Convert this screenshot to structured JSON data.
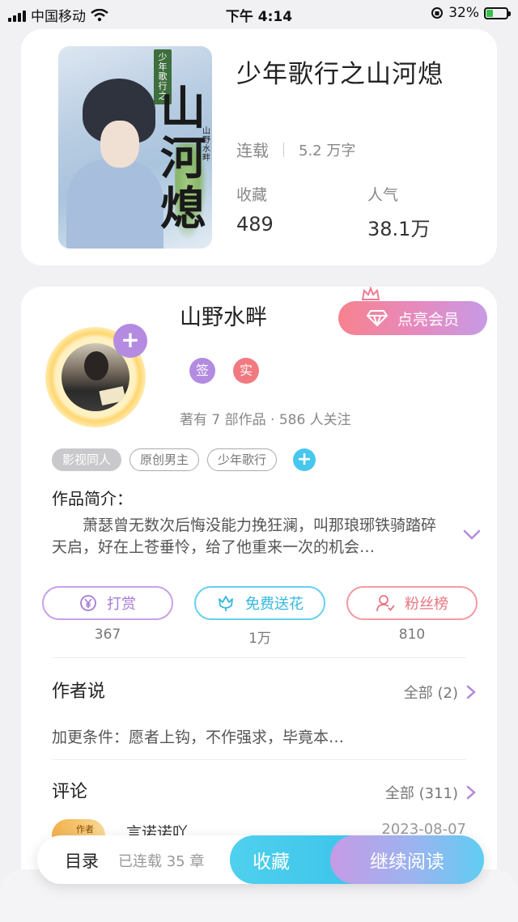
{
  "status_bar": {
    "carrier": "中国移动",
    "time": "下午 4:14",
    "battery": "32%",
    "battery_level": 0.32
  },
  "book": {
    "title": "少年歌行之山河熄",
    "cover_series_tag": "少年歌行之",
    "cover_title": "山河熄",
    "cover_author": "山野水畔",
    "status": "连载",
    "word_count": "5.2 万字",
    "favorites_label": "收藏",
    "favorites_value": "489",
    "popularity_label": "人气",
    "popularity_value": "38.1万"
  },
  "author": {
    "name": "山野水畔",
    "vip_button": "点亮会员",
    "badge_signed": "签",
    "badge_real": "实",
    "stats": "著有 7 部作品 · 586 人关注",
    "follow_symbol": "+"
  },
  "tags": [
    "影视同人",
    "原创男主",
    "少年歌行"
  ],
  "tag_add_symbol": "+",
  "intro": {
    "title": "作品简介：",
    "text": "萧瑟曾无数次后悔没能力挽狂澜，叫那琅琊铁骑踏碎天启，好在上苍垂怜，给了他重来一次的机会…"
  },
  "actions": [
    {
      "label": "打赏",
      "icon": "yen-icon",
      "count": "367"
    },
    {
      "label": "免费送花",
      "icon": "flower-icon",
      "count": "1万"
    },
    {
      "label": "粉丝榜",
      "icon": "fans-icon",
      "count": "810"
    }
  ],
  "author_says": {
    "title": "作者说",
    "more": "全部 (2)",
    "text": "加更条件：愿者上钩，不作强求，毕竟本…"
  },
  "comments": {
    "title": "评论",
    "more": "全部 (311)",
    "first": {
      "badge": "作者",
      "name": "言诺诺吖",
      "date": "2023-08-07"
    }
  },
  "bottom_bar": {
    "toc": "目录",
    "serial_count": "已连载 35 章",
    "favorite": "收藏",
    "continue_reading": "继续阅读"
  },
  "colors": {
    "accent_blue": "#39c1ea",
    "accent_purple": "#b48be0",
    "accent_pink": "#f07a80"
  }
}
